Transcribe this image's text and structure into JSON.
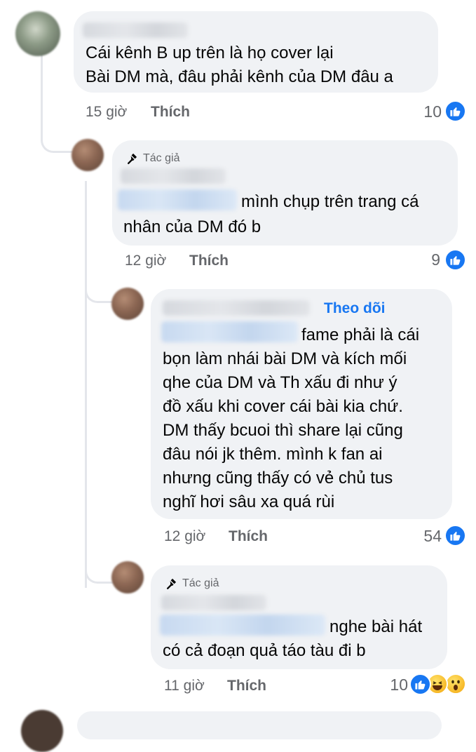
{
  "c1": {
    "text1": "Cái kênh B up trên  là họ cover lại",
    "text2": "Bài DM mà, đâu phải kênh của DM đâu a",
    "time": "15 giờ",
    "like": "Thích",
    "count": "10"
  },
  "c2": {
    "badge": "Tác giả",
    "text1": "mình chụp trên trang cá",
    "text2": "nhân của DM đó b",
    "time": "12 giờ",
    "like": "Thích",
    "count": "9"
  },
  "c3": {
    "follow": "Theo dõi",
    "lines": [
      "fame phải là cái",
      "bọn làm nhái bài DM và kích mối",
      "qhe của DM và Th xấu đi như ý",
      "đồ xấu khi cover cái bài kia chứ.",
      "DM thấy bcuoi thì share lại cũng",
      "đâu nói jk thêm. mình k fan ai",
      "nhưng cũng thấy có vẻ chủ tus",
      "nghĩ hơi sâu xa quá rùi"
    ],
    "time": "12 giờ",
    "like": "Thích",
    "count": "54"
  },
  "c4": {
    "badge": "Tác giả",
    "text1": "nghe bài hát",
    "text2": "có cả đoạn quả táo tàu đi b",
    "time": "11 giờ",
    "like": "Thích",
    "count": "10"
  },
  "colors": {
    "bubble": "#f0f2f5",
    "like_blue": "#1877f2",
    "meta": "#65676b"
  },
  "icons": {
    "like": "thumbs-up-icon",
    "haha": "haha-emoji-icon",
    "wow": "wow-emoji-icon",
    "author": "microphone-icon"
  }
}
